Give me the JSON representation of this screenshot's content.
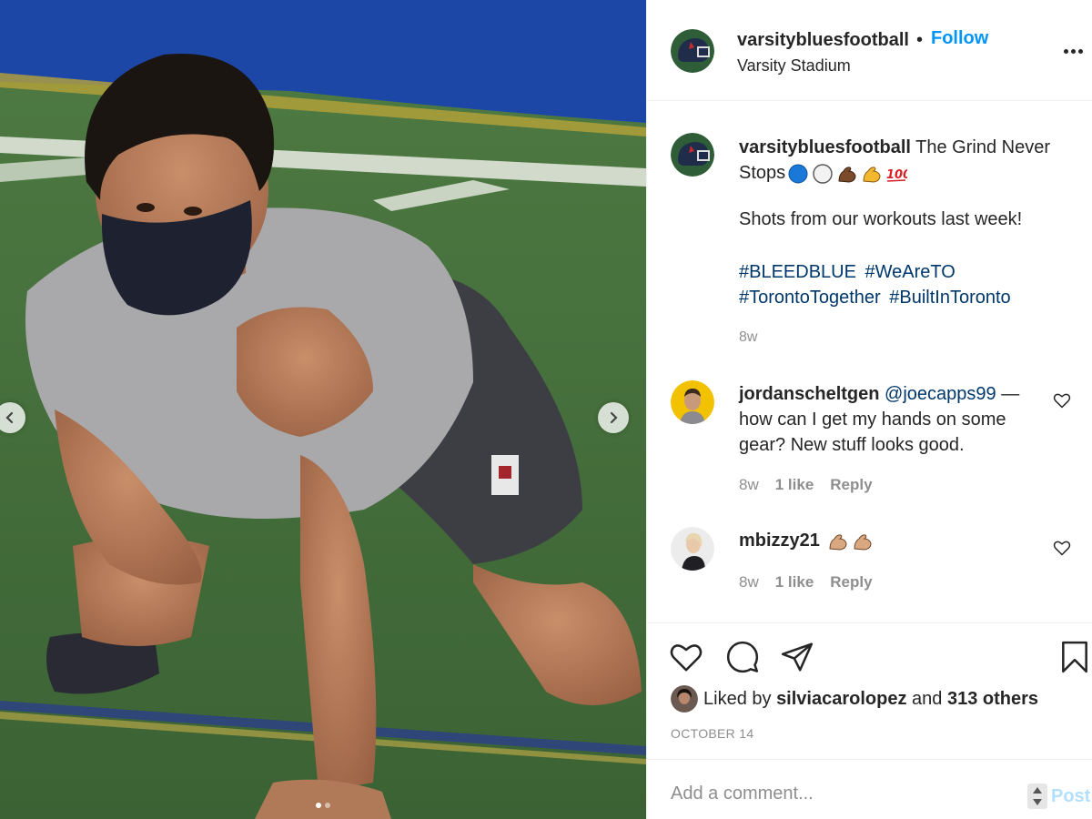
{
  "post": {
    "carousel": {
      "slide_count": 2,
      "active_slide": 1
    },
    "header": {
      "username": "varsitybluesfootball",
      "separator": "•",
      "follow_label": "Follow",
      "location": "Varsity Stadium"
    },
    "caption": {
      "username": "varsitybluesfootball",
      "text": "The Grind Never Stops",
      "emojis": [
        "blue-circle-emoji",
        "white-circle-emoji",
        "flexed-biceps-dark-emoji",
        "flexed-biceps-emoji",
        "hundred-points-emoji"
      ],
      "line2": "Shots from our workouts last week!",
      "hashtags": [
        "#BLEEDBLUE",
        "#WeAreTO",
        "#TorontoTogether",
        "#BuiltInToronto"
      ],
      "time": "8w"
    },
    "comments": [
      {
        "username": "jordanscheltgen",
        "mention": "@joecapps99",
        "text": " — how can I get my hands on some gear? New stuff looks good.",
        "time": "8w",
        "likes": "1 like",
        "reply_label": "Reply"
      },
      {
        "username": "mbizzy21",
        "text": "",
        "emojis": [
          "flexed-biceps-medium-emoji",
          "flexed-biceps-medium-emoji"
        ],
        "time": "8w",
        "likes": "1 like",
        "reply_label": "Reply"
      }
    ],
    "likes": {
      "prefix": "Liked by",
      "user": "silviacarolopez",
      "middle": "and",
      "others": "313 others"
    },
    "date": "OCTOBER 14",
    "comment_box": {
      "placeholder": "Add a comment...",
      "post_label": "Post"
    }
  },
  "colors": {
    "link_blue": "#0095f6",
    "hashtag_blue": "#00376b",
    "muted": "#8e8e8e",
    "post_disabled": "#b2dffc"
  }
}
